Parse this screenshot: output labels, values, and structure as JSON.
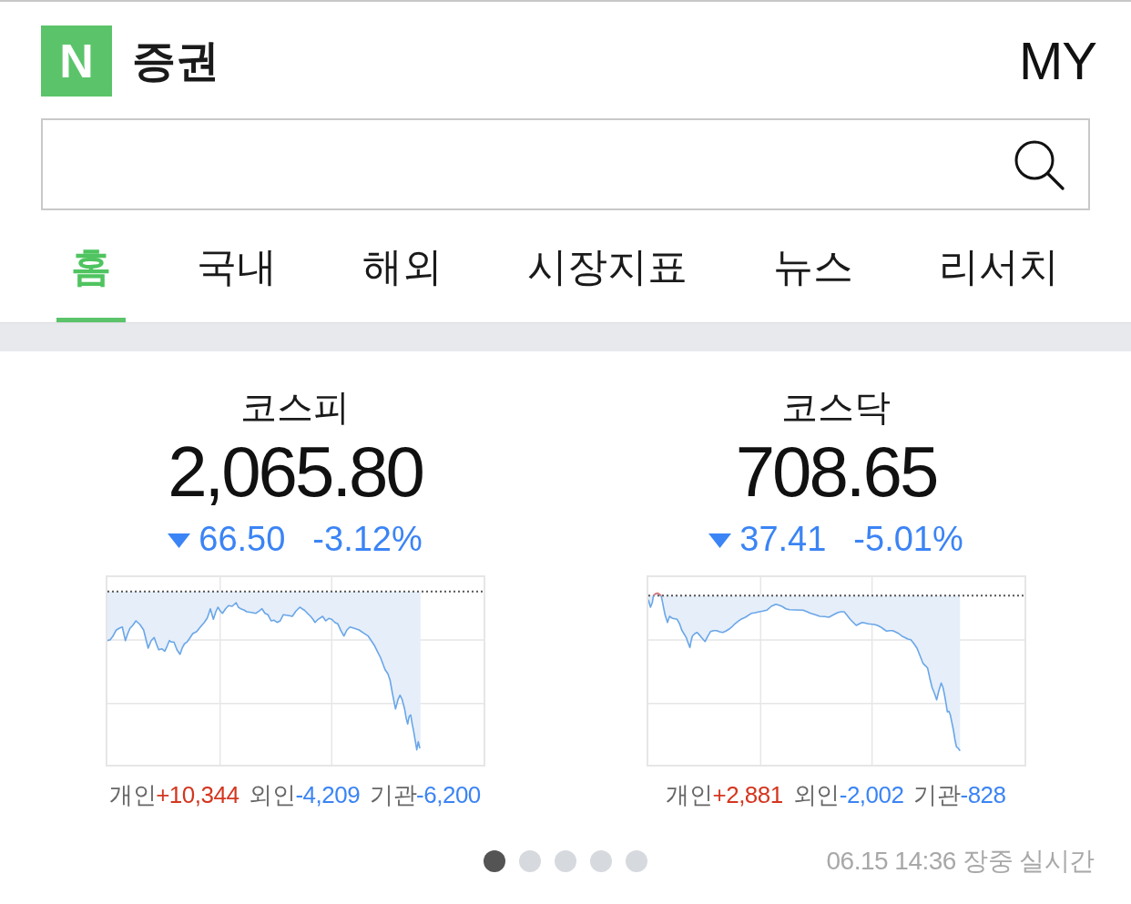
{
  "header": {
    "logo": "N",
    "title": "증권",
    "my_link": "MY"
  },
  "tabs": [
    {
      "label": "홈",
      "selected": true
    },
    {
      "label": "국내",
      "selected": false
    },
    {
      "label": "해외",
      "selected": false
    },
    {
      "label": "시장지표",
      "selected": false
    },
    {
      "label": "뉴스",
      "selected": false
    },
    {
      "label": "리서치",
      "selected": false
    }
  ],
  "indices": [
    {
      "name": "코스피",
      "value": "2,065.80",
      "falling": true,
      "change": "66.50",
      "change_rate": "-3.12%",
      "investors": [
        {
          "label": "개인",
          "value": "+10,344",
          "color": "#d4361f"
        },
        {
          "label": "외인",
          "value": "-4,209",
          "color": "#3b84f5"
        },
        {
          "label": "기관",
          "value": "-6,200",
          "color": "#3b84f5"
        }
      ]
    },
    {
      "name": "코스닥",
      "value": "708.65",
      "falling": true,
      "change": "37.41",
      "change_rate": "-5.01%",
      "investors": [
        {
          "label": "개인",
          "value": "+2,881",
          "color": "#d4361f"
        },
        {
          "label": "외인",
          "value": "-2,002",
          "color": "#3b84f5"
        },
        {
          "label": "기관",
          "value": "-828",
          "color": "#3b84f5"
        }
      ]
    }
  ],
  "pages": [
    {
      "selected": true
    },
    {
      "selected": false
    },
    {
      "selected": false
    },
    {
      "selected": false
    },
    {
      "selected": false
    }
  ],
  "status": "06.15 14:36 장중 실시간"
}
